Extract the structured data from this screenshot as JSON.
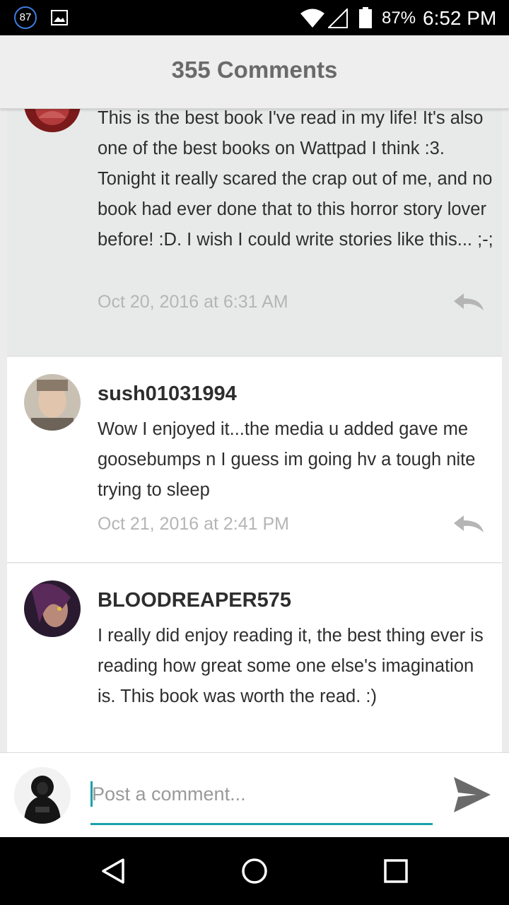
{
  "status_bar": {
    "notification_count": "87",
    "battery_percent": "87%",
    "time": "6:52 PM",
    "icons": [
      "notification-badge",
      "image-icon",
      "wifi-icon",
      "signal-icon",
      "battery-icon"
    ]
  },
  "header": {
    "title": "355 Comments"
  },
  "comments": [
    {
      "username": "",
      "text": "This is the best book I've read in my life! It's also one of the best books on Wattpad I think :3. Tonight it really scared the crap out of me, and no book had ever done that to this horror story lover before! :D. I wish I could write stories like this... ;-;",
      "date": "Oct 20, 2016 at 6:31 AM",
      "highlighted": true,
      "avatar_color": "#8e2424"
    },
    {
      "username": "sush01031994",
      "text": "Wow I enjoyed it...the media u added gave me goosebumps n I guess im going hv a tough nite trying to sleep",
      "date": "Oct 21, 2016 at 2:41 PM",
      "highlighted": false,
      "avatar_color": "#b9b1a6"
    },
    {
      "username": "BLOODREAPER575",
      "text": "I really did enjoy reading it, the best thing ever is reading how great some one else's imagination is. This book was worth the read. :)",
      "date": "",
      "highlighted": false,
      "avatar_color": "#3a2440"
    }
  ],
  "composer": {
    "placeholder": "Post a comment...",
    "value": "",
    "accent_color": "#1aa1a8"
  },
  "nav_bar": {
    "icons": [
      "back-icon",
      "home-icon",
      "recents-icon"
    ]
  }
}
